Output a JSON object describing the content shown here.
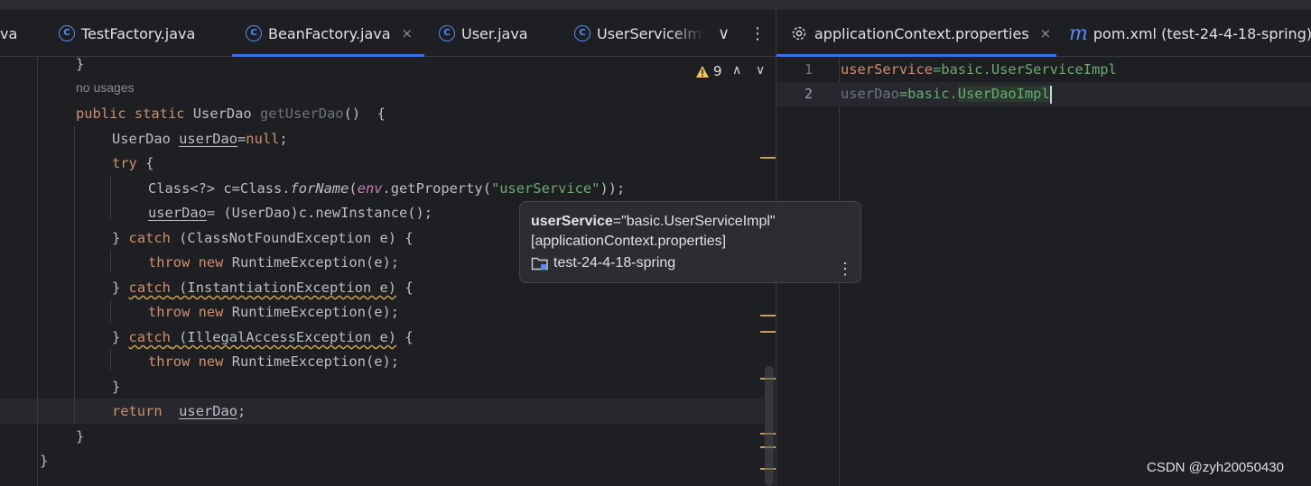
{
  "left_tabs": [
    {
      "label": "va"
    },
    {
      "label": "TestFactory.java"
    },
    {
      "label": "BeanFactory.java",
      "active": true
    },
    {
      "label": "User.java"
    },
    {
      "label": "UserServiceImpl"
    }
  ],
  "right_tabs": [
    {
      "label": "applicationContext.properties",
      "active": true
    },
    {
      "label": "pom.xml (test-24-4-18-spring)"
    }
  ],
  "close_glyph": "×",
  "more_glyph": "⋮",
  "chevron_down": "∨",
  "chevron_up": "∧",
  "inspection": {
    "warning_count": "9"
  },
  "code": {
    "closing_brace_top": "}",
    "usage_hint": "no usages",
    "sig": {
      "kw1": "public",
      "kw2": "static",
      "type": "UserDao",
      "name": "getUserDao",
      "rest": "()  {"
    },
    "decl": {
      "type": "UserDao ",
      "var": "userDao",
      "eq": "=",
      "null": "null",
      "semi": ";"
    },
    "try": {
      "kw": "try",
      "brace": " {"
    },
    "forname": {
      "a": "Class<?> c=Class.",
      "fn": "forName",
      "b": "(",
      "env": "env",
      "c": ".getProperty(",
      "str": "\"userService\"",
      "d": "));"
    },
    "assign": {
      "var": "userDao",
      "rest": "= (UserDao)c.newInstance();"
    },
    "catch1": {
      "open": "} ",
      "kw": "catch",
      "rest": " (ClassNotFoundException e) {"
    },
    "throw": {
      "kw1": "throw",
      "kw2": "new",
      "rest": " RuntimeException(e);"
    },
    "catch2": {
      "open": "} ",
      "kw": "catch",
      "rest": " (InstantiationException e)",
      "tail": " {"
    },
    "catch3": {
      "open": "} ",
      "kw": "catch",
      "rest": " (IllegalAccessException e)",
      "tail": " {"
    },
    "close_inner": "}",
    "ret": {
      "kw": "return",
      "var": "userDao",
      "semi": ";"
    },
    "close_method": "}",
    "close_class": "}"
  },
  "properties": {
    "line_numbers": [
      "1",
      "2"
    ],
    "lines": [
      {
        "key": "userService",
        "eq": "=",
        "value": "basic.UserServiceImpl"
      },
      {
        "key": "userDao",
        "eq": "=",
        "value_prefix": "basic.",
        "value_hl": "UserDaoImpl"
      }
    ]
  },
  "tooltip": {
    "key": "userService",
    "value": "=\"basic.UserServiceImpl\"",
    "file": "[applicationContext.properties]",
    "module": "test-24-4-18-spring"
  },
  "watermark": "CSDN @zyh20050430",
  "colors": {
    "accent": "#3574f0",
    "keyword": "#cf8e6d",
    "string": "#6aab73",
    "warning": "#c6a052"
  }
}
